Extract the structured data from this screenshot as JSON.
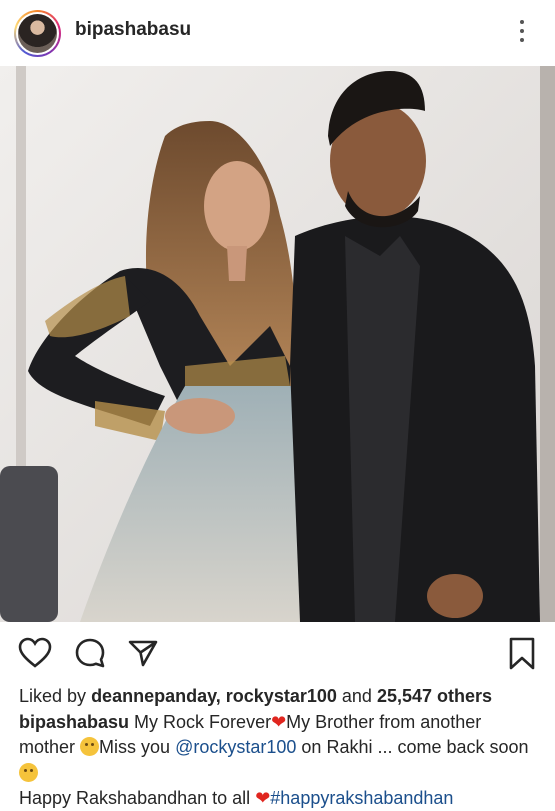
{
  "header": {
    "username": "bipashabasu"
  },
  "photo": {
    "description_icon": "post-photo"
  },
  "actions": {
    "icons": [
      "heart-icon",
      "comment-icon",
      "share-icon",
      "bookmark-icon"
    ]
  },
  "likes": {
    "prefix": "Liked by",
    "user1": "deannepanday,",
    "user2": "rockystar100",
    "and": "and",
    "count": "25,547 others"
  },
  "caption": {
    "username": "bipashabasu",
    "text1": "My Rock Forever",
    "text2": "My Brother from another mother",
    "text3": "Miss you",
    "mention": "@rockystar100",
    "text4": "on Rakhi ... come back soon",
    "text5": "Happy Rakshabandhan to all",
    "hashtag": "#happyrakshabandhan"
  },
  "colors": {
    "link": "#1b4f8c",
    "heart": "#e0261f",
    "text": "#262626"
  }
}
